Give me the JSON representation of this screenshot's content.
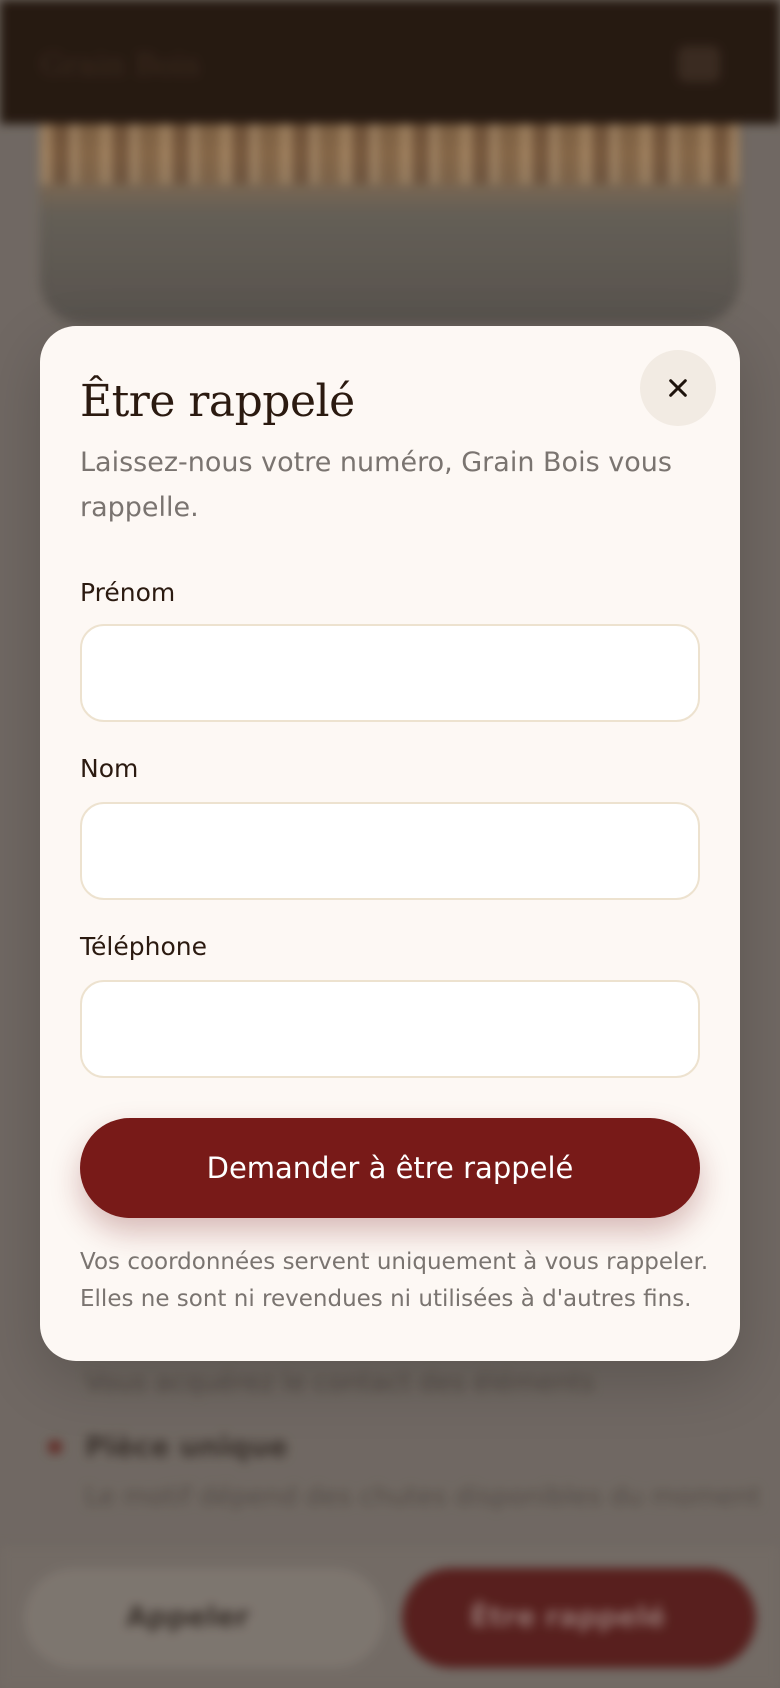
{
  "background": {
    "brand": "Grain Bois",
    "feature_text_1": "Vous acquérez le contact des éléments",
    "feature_title_2": "Pièce unique",
    "feature_text_2": "Le motif dépend des chutes disponibles du moment",
    "bottom_bar": {
      "call_label": "Appeler",
      "callback_label": "Être rappelé"
    }
  },
  "modal": {
    "title": "Être rappelé",
    "subtitle": "Laissez-nous votre numéro, Grain Bois vous rappelle.",
    "close_icon": "close-icon",
    "fields": [
      {
        "label": "Prénom",
        "value": ""
      },
      {
        "label": "Nom",
        "value": ""
      },
      {
        "label": "Téléphone",
        "value": ""
      }
    ],
    "submit_label": "Demander à être rappelé",
    "privacy_line_1": "Vos coordonnées servent uniquement à vous rappeler.",
    "privacy_line_2": "Elles ne sont ni revendues ni utilisées à d'autres fins."
  },
  "colors": {
    "accent": "#781a18",
    "header": "#22150c",
    "modal_bg": "#fdf8f4",
    "input_border": "#ede2cf"
  }
}
